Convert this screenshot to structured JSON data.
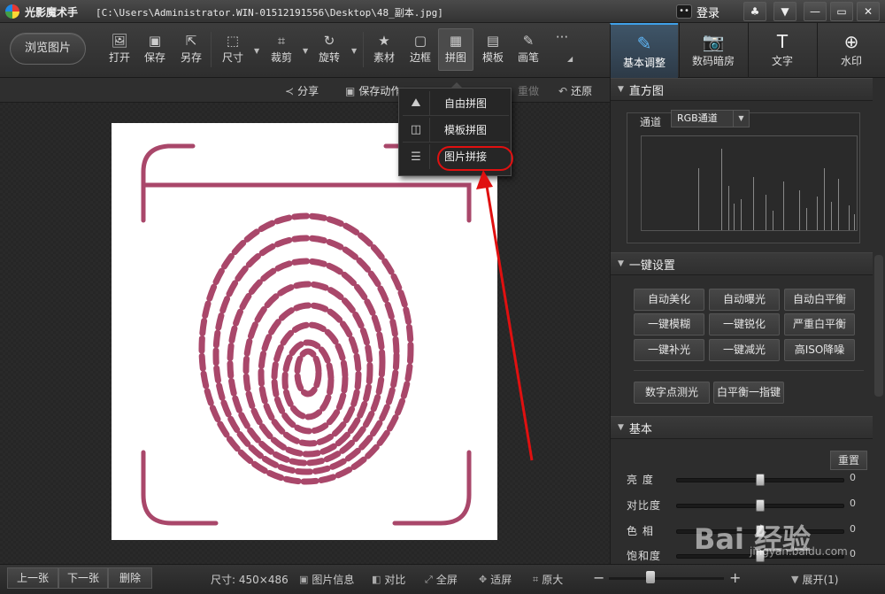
{
  "window": {
    "app_name": "光影魔术手",
    "file_path": "[C:\\Users\\Administrator.WIN-01512191556\\Desktop\\48_副本.jpg]",
    "login_label": "登录",
    "btn_skin": "♣",
    "btn_menu": "▼",
    "btn_min": "—",
    "btn_max": "▭",
    "btn_close": "✕"
  },
  "toolbar": {
    "browse_label": "浏览图片",
    "tools": [
      {
        "label": "打开",
        "icon": "open-icon"
      },
      {
        "label": "保存",
        "icon": "save-icon"
      },
      {
        "label": "另存",
        "icon": "save-as-icon"
      },
      {
        "label": "尺寸",
        "icon": "resize-icon"
      },
      {
        "label": "裁剪",
        "icon": "crop-icon"
      },
      {
        "label": "旋转",
        "icon": "rotate-icon"
      },
      {
        "label": "素材",
        "icon": "material-icon"
      },
      {
        "label": "边框",
        "icon": "border-icon"
      },
      {
        "label": "拼图",
        "icon": "collage-icon",
        "active": true
      },
      {
        "label": "模板",
        "icon": "template-icon"
      },
      {
        "label": "画笔",
        "icon": "brush-icon"
      }
    ],
    "more_label": "···"
  },
  "right_tabs": [
    {
      "label": "基本调整",
      "icon": "adjust-icon",
      "active": true
    },
    {
      "label": "数码暗房",
      "icon": "camera-icon"
    },
    {
      "label": "文字",
      "icon": "text-icon"
    },
    {
      "label": "水印",
      "icon": "watermark-icon"
    }
  ],
  "subbar": {
    "share": "分享",
    "save_action": "保存动作",
    "redo": "重做",
    "restore": "还原"
  },
  "dropdown": {
    "items": [
      {
        "label": "自由拼图",
        "icon": "free-collage-icon"
      },
      {
        "label": "模板拼图",
        "icon": "template-collage-icon"
      },
      {
        "label": "图片拼接",
        "icon": "image-stitch-icon",
        "highlighted": true
      }
    ]
  },
  "histogram": {
    "title": "直方图",
    "channel_label": "通道",
    "channel_value": "RGB通道"
  },
  "one_click": {
    "title": "一键设置",
    "buttons": [
      "自动美化",
      "自动曝光",
      "自动白平衡",
      "一键模糊",
      "一键锐化",
      "严重白平衡",
      "一键补光",
      "一键减光",
      "高ISO降噪"
    ],
    "extra": [
      "数字点测光",
      "白平衡一指键"
    ]
  },
  "basic": {
    "title": "基本",
    "reset": "重置",
    "sliders": [
      {
        "label": "亮  度",
        "value": "0",
        "level": 0.5
      },
      {
        "label": "对比度",
        "value": "0",
        "level": 0.5
      },
      {
        "label": "色  相",
        "value": "0",
        "level": 0.5
      },
      {
        "label": "饱和度",
        "value": "0",
        "level": 0.5
      }
    ]
  },
  "statusbar": {
    "prev": "上一张",
    "next": "下一张",
    "delete": "删除",
    "size": "尺寸: 450×486",
    "info": "图片信息",
    "compare": "对比",
    "fullscreen": "全屏",
    "fit": "适屏",
    "original": "原大",
    "zoom_minus": "−",
    "zoom_plus": "+",
    "expand": "展开(1)"
  },
  "watermark": {
    "text": "Bai 经验",
    "url": "jingyan.baidu.com"
  },
  "colors": {
    "accent": "#3fa0e8",
    "fingerprint": "#a9476a",
    "annotation": "#e01010"
  }
}
